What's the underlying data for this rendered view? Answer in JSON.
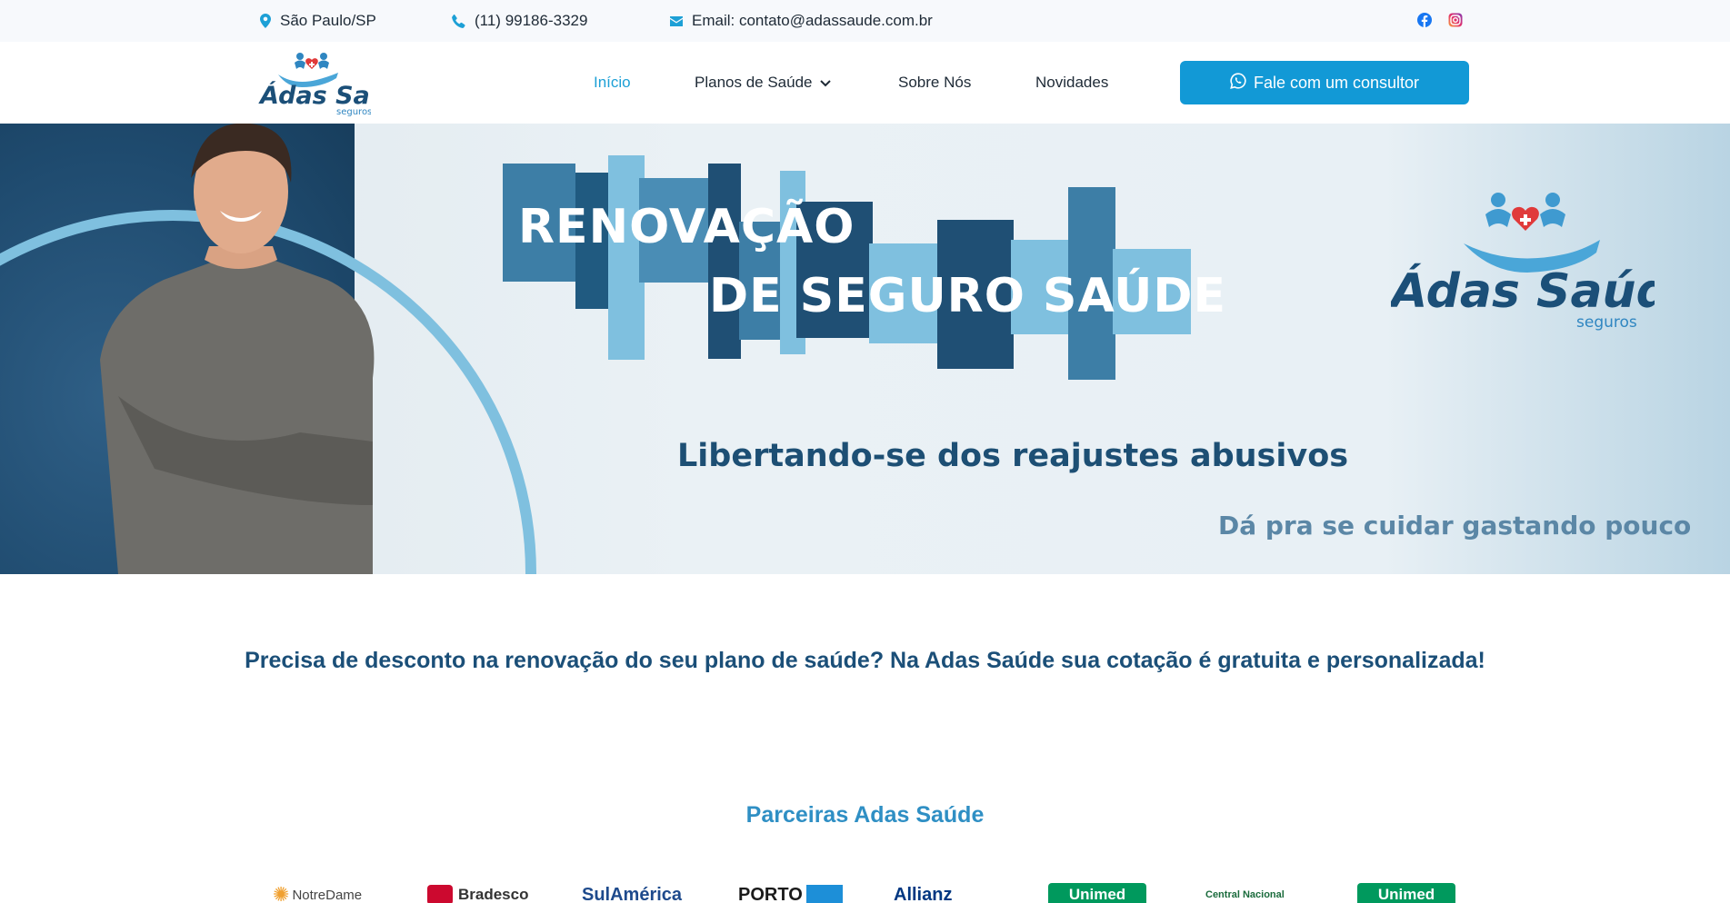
{
  "topbar": {
    "location": "São Paulo/SP",
    "phone": "(11) 99186-3329",
    "email": "Email: contato@adassaude.com.br",
    "social": [
      "facebook-icon",
      "instagram-icon"
    ]
  },
  "brand": {
    "name": "Adas Saúde",
    "sub": "seguros",
    "colors": {
      "primary": "#1b4f78",
      "accent": "#1299d6",
      "light": "#7fc0df"
    }
  },
  "nav": {
    "items": [
      {
        "label": "Início",
        "active": true
      },
      {
        "label": "Planos de Saúde",
        "dropdown": true
      },
      {
        "label": "Sobre Nós"
      },
      {
        "label": "Novidades"
      }
    ],
    "cta": "Fale com um consultor"
  },
  "hero": {
    "title_line1": "RENOVAÇÃO",
    "title_line2": "DE SEGURO SAÚDE",
    "subtitle": "Libertando-se dos reajustes abusivos",
    "tagline": "Dá pra se cuidar gastando pouco"
  },
  "content": {
    "headline": "Precisa de desconto na renovação do seu plano de saúde? Na Adas Saúde sua cotação é gratuita e personalizada!",
    "partners_title": "Parceiras Adas Saúde",
    "partners": [
      "NotreDame",
      "Bradesco",
      "SulAmérica",
      "PORTO",
      "Allianz",
      "Unimed",
      "Central Nacional",
      "Unimed"
    ]
  }
}
